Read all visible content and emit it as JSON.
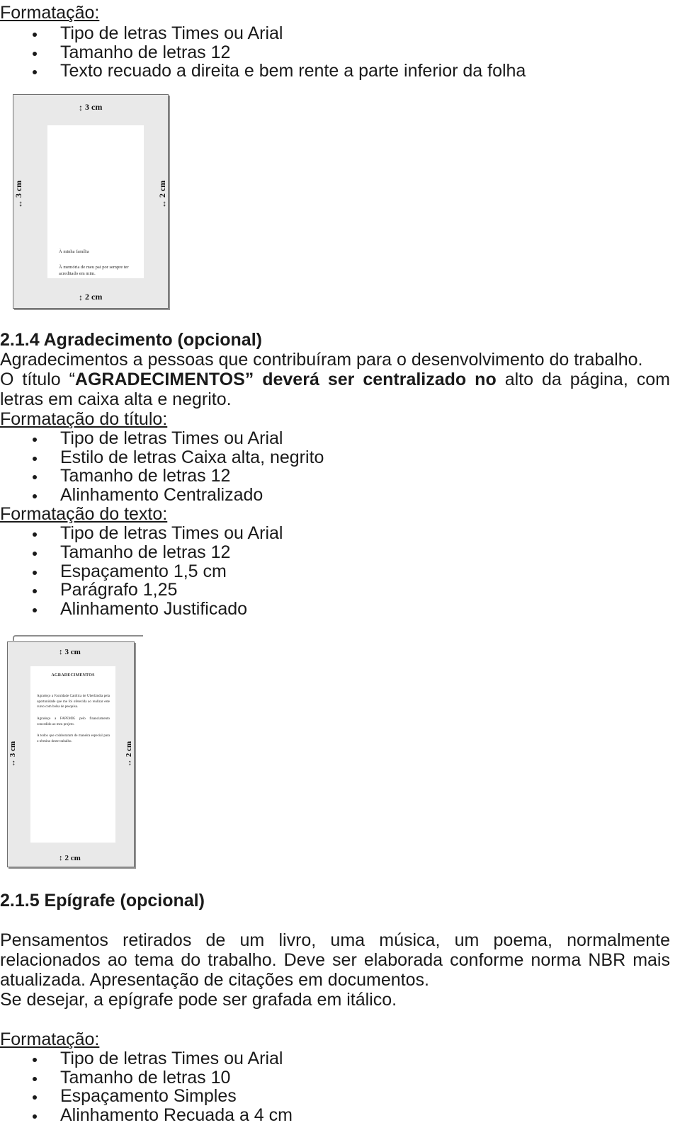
{
  "document": {
    "language": "pt-BR",
    "section_1": {
      "formatting_label": "Formatação:",
      "items": [
        "Tipo de letras Times ou Arial",
        "Tamanho de letras 12",
        "Texto recuado a direita e bem rente a parte inferior da folha"
      ]
    },
    "figure_dedication": {
      "caption_top": "3 cm",
      "caption_left": "3 cm",
      "caption_right": "2 cm",
      "caption_bottom": "2 cm",
      "arrow_vertical": "↕",
      "arrow_horizontal": "↔",
      "dedication_line_1": "À minha família",
      "dedication_line_2": "À memória de meu pai por sempre ter acreditado em mim."
    },
    "section_2_1_4": {
      "heading": "2.1.4 Agradecimento (opcional)",
      "paragraph_1": "Agradecimentos a pessoas que contribuíram para o desenvolvimento do trabalho.",
      "paragraph_2_part_1": "O título “",
      "paragraph_2_bold_1": "AGRADECIMENTOS”  deverá  ser  centralizado  no",
      "paragraph_2_part_2": " alto  da  página,  com  letras  em caixa alta e negrito.",
      "title_format_label": "Formatação do título:",
      "title_format_items": [
        "Tipo de letras Times ou Arial",
        "Estilo de letras Caixa alta, negrito",
        "Tamanho de letras 12",
        "Alinhamento Centralizado"
      ],
      "text_format_label": "Formatação do texto:",
      "text_format_items": [
        "Tipo de letras Times ou Arial",
        "Tamanho de letras 12",
        "Espaçamento 1,5 cm",
        "Parágrafo 1,25",
        "Alinhamento Justificado"
      ]
    },
    "figure_acknowledgements": {
      "caption_top": "3 cm",
      "caption_left": "3 cm",
      "caption_right": "2 cm",
      "caption_bottom": "2 cm",
      "arrow_vertical": "↕",
      "arrow_horizontal": "↔",
      "page_title": "AGRADECIMENTOS",
      "paragraph_1": "Agradeço a Faculdade Católica de Uberlândia pela oportunidade que me foi oferecida ao realizar este curso com bolsa de pesquisa.",
      "paragraph_2": "Agradeço a FAPEMIG pelo financiamento concedido ao meu projeto.",
      "paragraph_3": "A todos que colaboraram de maneira especial para o término deste trabalho."
    },
    "section_2_1_5": {
      "heading": "2.1.5  Epígrafe (opcional)",
      "paragraph_1": "Pensamentos  retirados  de  um  livro,  uma  música,  um  poema,  normalmente  relacionados  ao tema do trabalho. Deve ser elaborada conforme norma NBR mais atualizada. Apresentação de citações em documentos.",
      "paragraph_2": "Se desejar, a epígrafe pode ser grafada em itálico.",
      "formatting_label": "Formatação:",
      "items": [
        "Tipo de letras Times ou Arial",
        "Tamanho de letras 10",
        "Espaçamento Simples",
        "Alinhamento Recuada a 4 cm"
      ]
    },
    "colors": {
      "text": "#1a1a1a",
      "figure_margin_fill": "#e9e9e9",
      "figure_border": "#6f6f6f",
      "sheet_fill": "#ffffff"
    }
  }
}
